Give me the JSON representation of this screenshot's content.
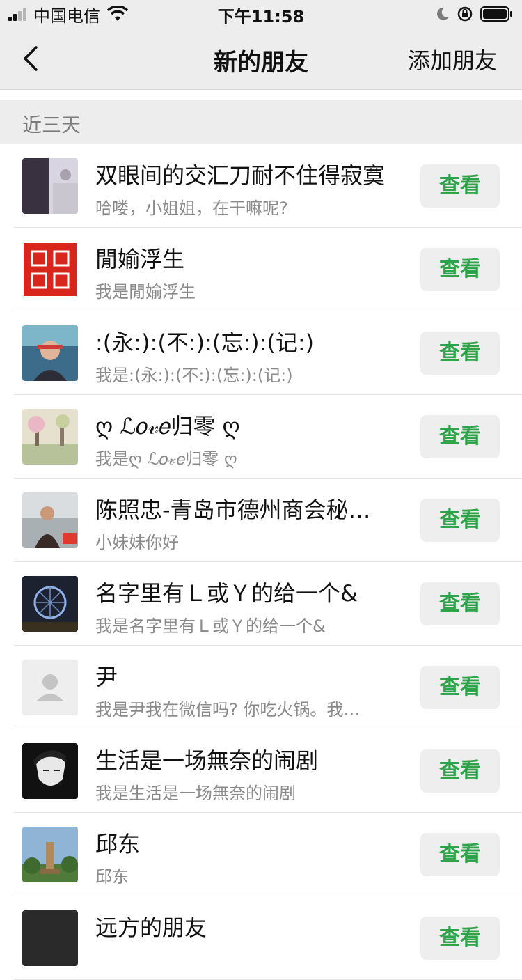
{
  "status_bar": {
    "carrier": "中国电信",
    "time": "下午11:58",
    "icons": [
      "signal-icon",
      "wifi-icon",
      "moon-icon",
      "orientation-lock-icon",
      "battery-icon"
    ]
  },
  "nav": {
    "back_icon": "chevron-left-icon",
    "title": "新的朋友",
    "action": "添加朋友"
  },
  "section_header": "近三天",
  "accent_color": "#2fa34a",
  "contacts": [
    {
      "name": "双眼间的交汇刀耐不住得寂寞",
      "message": "哈喽，小姐姐，在干嘛呢?",
      "button": "查看"
    },
    {
      "name": "閒媮浮生",
      "message": "我是閒媮浮生",
      "button": "查看"
    },
    {
      "name": ":(永:):(不:):(忘:):(记:)",
      "message": "我是:(永:):(不:):(忘:):(记:)",
      "button": "查看"
    },
    {
      "name": "ღ ℒ𝑜𝓋𝑒归零 ღ",
      "message": "我是ღ ℒ𝑜𝓋𝑒归零 ღ",
      "button": "查看"
    },
    {
      "name": "陈照忠-青岛市德州商会秘…",
      "message": "小妹妹你好",
      "button": "查看"
    },
    {
      "name": "名字里有Ｌ或Ｙ的给一个&",
      "message": "我是名字里有Ｌ或Ｙ的给一个&",
      "button": "查看"
    },
    {
      "name": "尹",
      "message": "我是尹我在微信吗? 你吃火锅。我…",
      "button": "查看"
    },
    {
      "name": "生活是一场無奈的闹剧",
      "message": "我是生活是一场無奈的闹剧",
      "button": "查看"
    },
    {
      "name": "邱东",
      "message": "邱东",
      "button": "查看"
    },
    {
      "name": "远方的朋友",
      "message": "",
      "button": "查看"
    }
  ]
}
